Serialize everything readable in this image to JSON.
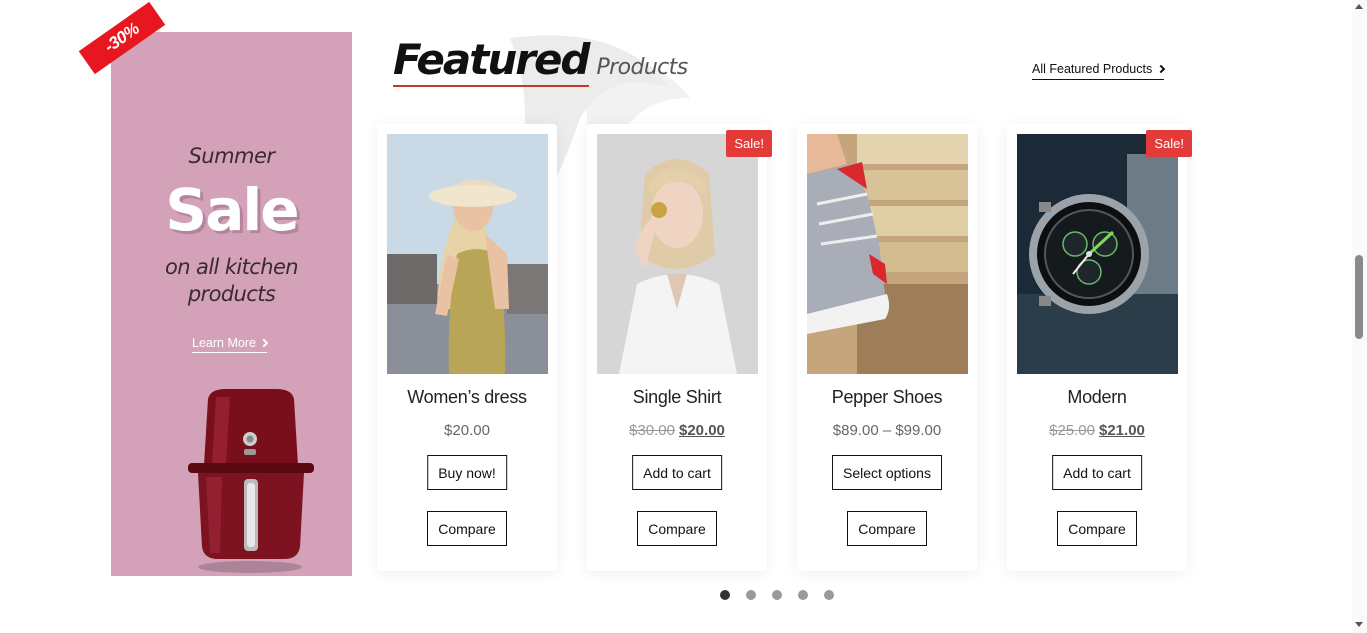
{
  "promo": {
    "badge": "-30%",
    "line1": "Summer",
    "line2": "Sale",
    "line3": "on all kitchen",
    "line4": "products",
    "link_label": "Learn More"
  },
  "heading": {
    "main": "Featured",
    "sub": "Products",
    "all_link": "All Featured Products"
  },
  "products": [
    {
      "name": "Women’s dress",
      "price": "$20.00",
      "old_price": "",
      "new_price": "",
      "sale": "",
      "action": "Buy now!",
      "compare": "Compare"
    },
    {
      "name": "Single Shirt",
      "price": "",
      "old_price": "$30.00",
      "new_price": "$20.00",
      "sale": "Sale!",
      "action": "Add to cart",
      "compare": "Compare"
    },
    {
      "name": "Pepper Shoes",
      "price": "$89.00 – $99.00",
      "old_price": "",
      "new_price": "",
      "sale": "",
      "action": "Select options",
      "compare": "Compare"
    },
    {
      "name": "Modern",
      "price": "",
      "old_price": "$25.00",
      "new_price": "$21.00",
      "sale": "Sale!",
      "action": "Add to cart",
      "compare": "Compare"
    }
  ],
  "carousel": {
    "pages": 5,
    "active": 1
  },
  "colors": {
    "promo_bg": "#d3a2b9",
    "ribbon": "#e8171f",
    "sale_badge": "#e33a3a",
    "heading_underline": "#c0392b"
  }
}
